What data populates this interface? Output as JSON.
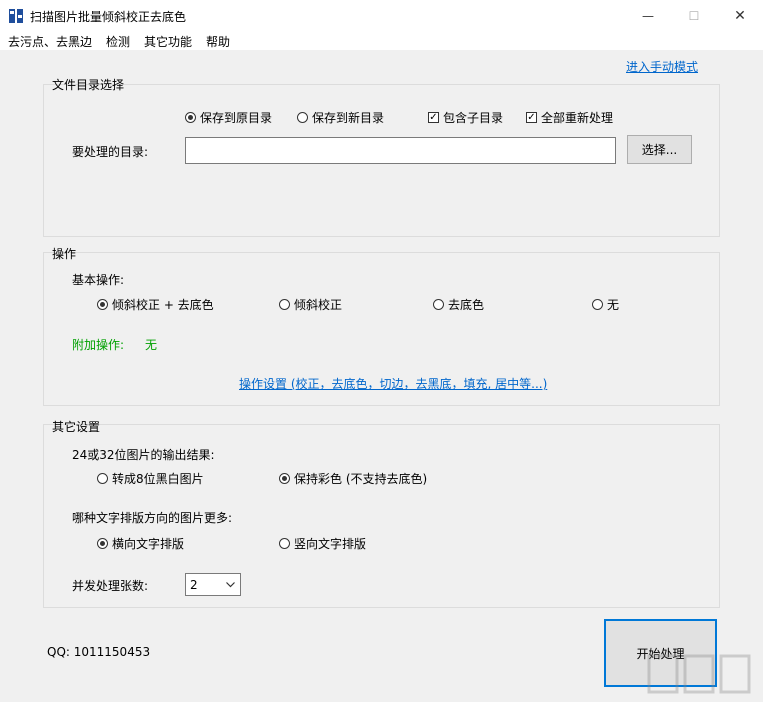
{
  "window": {
    "title": "扫描图片批量倾斜校正去底色",
    "minimize_glyph": "—",
    "maximize_glyph": "☐",
    "close_glyph": "✕"
  },
  "menu": [
    "去污点、去黑边",
    "检测",
    "其它功能",
    "帮助"
  ],
  "manual_mode_link": "进入手动模式",
  "directory_group": {
    "title": "文件目录选择",
    "save_original": "保存到原目录",
    "save_new": "保存到新目录",
    "include_subdir": "包含子目录",
    "reprocess_all": "全部重新处理",
    "dir_label": "要处理的目录:",
    "dir_value": "",
    "choose_button": "选择..."
  },
  "operation_group": {
    "title": "操作",
    "basic_label": "基本操作:",
    "options": [
      "倾斜校正 + 去底色",
      "倾斜校正",
      "去底色",
      "无"
    ],
    "extra_label": "附加操作:",
    "extra_value": "无",
    "settings_link": "操作设置 (校正，去底色，切边，去黑底，填充, 居中等...)"
  },
  "other_group": {
    "title": "其它设置",
    "output_label": "24或32位图片的输出结果:",
    "output_options": [
      "转成8位黑白图片",
      "保持彩色 (不支持去底色)"
    ],
    "direction_label": "哪种文字排版方向的图片更多:",
    "direction_options": [
      "横向文字排版",
      "竖向文字排版"
    ],
    "concurrency_label": "并发处理张数:",
    "concurrency_value": "2"
  },
  "qq_text": "QQ: 1011150453",
  "start_button": "开始处理",
  "colors": {
    "link": "#0066cc",
    "green": "#00a000"
  }
}
